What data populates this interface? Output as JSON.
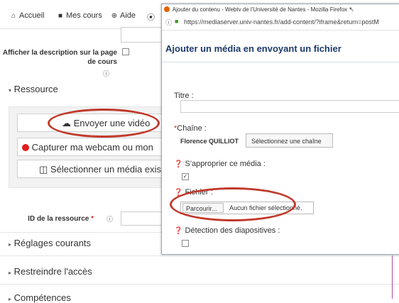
{
  "nav": {
    "home": "Accueil",
    "courses": "Mes cours",
    "help": "Aide"
  },
  "form": {
    "show_desc_line1": "Afficher la description sur la page",
    "show_desc_line2": "de cours",
    "resource_section": "Ressource",
    "upload_video": "Envoyer une vidéo",
    "capture_webcam": "Capturer ma webcam ou mon",
    "select_media": "Sélectionner un média exis",
    "resource_id_label": "ID de la ressource",
    "general_settings": "Réglages courants",
    "restrict_access": "Restreindre l'accès",
    "competencies": "Compétences"
  },
  "popup": {
    "window_title": "Ajouter du contenu - Webtv de l'Université de Nantes - Mozilla Firefox",
    "url": "https://mediaserver.univ-nantes.fr/add-content/?iframe&return=postM",
    "heading": "Ajouter un média en envoyant un fichier",
    "title_label": "Titre :",
    "channel_label": "Chaîne :",
    "channel_value": "Florence QUILLIOT",
    "select_channel_btn": "Sélectionnez une chaîne",
    "own_media_label": "S'approprier ce média :",
    "file_label": "Fichier :",
    "browse_btn": "Parcourir...",
    "no_file": "Aucun fichier sélectionné.",
    "slide_detection_label": "Détection des diapositives :"
  },
  "colors": {
    "annotation": "#c0392b",
    "heading_blue": "#1d3a6b",
    "required_red": "#c0392b"
  }
}
